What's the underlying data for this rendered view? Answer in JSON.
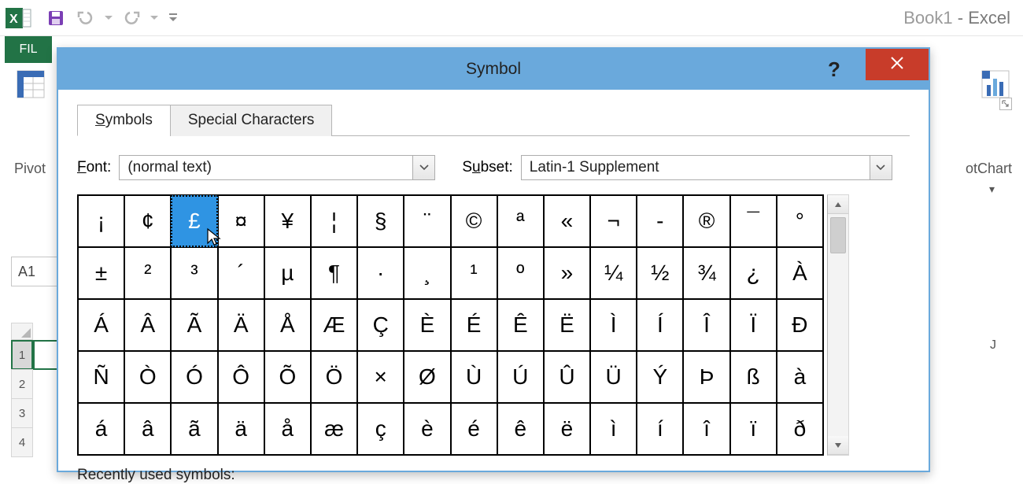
{
  "app": {
    "title_book": "Book1",
    "title_app": " - Excel",
    "file_tab": "FIL"
  },
  "ribbon": {
    "pivot_label": "Pivot",
    "pivotchart_partial": "otChart",
    "pivotchart_dropdown": "▾"
  },
  "name_box": "A1",
  "rows": [
    "1",
    "2",
    "3",
    "4"
  ],
  "col_j": "J",
  "dialog": {
    "title": "Symbol",
    "help": "?",
    "tabs": {
      "symbols": "ymbols",
      "special": "Special Characters",
      "s_prefix": "S"
    },
    "font_label_pre": "F",
    "font_label_post": "ont:",
    "font_value": "(normal text)",
    "subset_label_pre": "S",
    "subset_label_u": "u",
    "subset_label_post": "bset:",
    "subset_value": "Latin-1 Supplement",
    "recent": "Recently used symbols:",
    "grid": [
      [
        "¡",
        "¢",
        "£",
        "¤",
        "¥",
        "¦",
        "§",
        "¨",
        "©",
        "ª",
        "«",
        "¬",
        "­-",
        "®",
        "¯",
        "°"
      ],
      [
        "±",
        "²",
        "³",
        "´",
        "µ",
        "¶",
        "·",
        "¸",
        "¹",
        "º",
        "»",
        "¼",
        "½",
        "¾",
        "¿",
        "À"
      ],
      [
        "Á",
        "Â",
        "Ã",
        "Ä",
        "Å",
        "Æ",
        "Ç",
        "È",
        "É",
        "Ê",
        "Ë",
        "Ì",
        "Í",
        "Î",
        "Ï",
        "Ð"
      ],
      [
        "Ñ",
        "Ò",
        "Ó",
        "Ô",
        "Õ",
        "Ö",
        "×",
        "Ø",
        "Ù",
        "Ú",
        "Û",
        "Ü",
        "Ý",
        "Þ",
        "ß",
        "à"
      ],
      [
        "á",
        "â",
        "ã",
        "ä",
        "å",
        "æ",
        "ç",
        "è",
        "é",
        "ê",
        "ë",
        "ì",
        "í",
        "î",
        "ï",
        "ð"
      ]
    ],
    "selected": [
      0,
      2
    ]
  }
}
